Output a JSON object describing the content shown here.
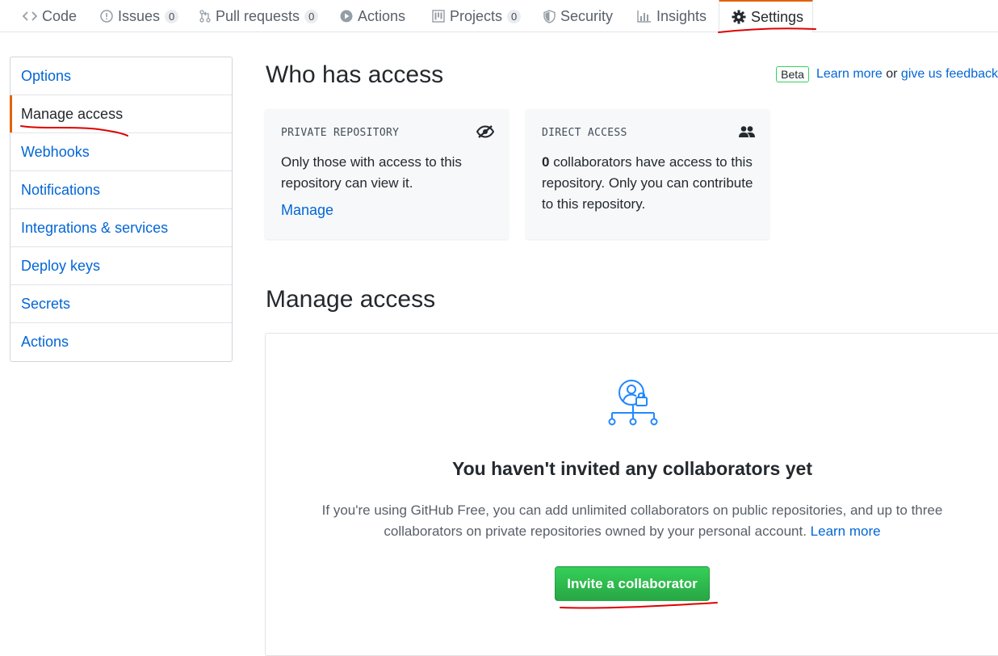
{
  "nav": {
    "tabs": [
      {
        "label": "Code",
        "icon": "code-icon"
      },
      {
        "label": "Issues",
        "icon": "issue-opened-icon",
        "count": "0"
      },
      {
        "label": "Pull requests",
        "icon": "git-pull-request-icon",
        "count": "0"
      },
      {
        "label": "Actions",
        "icon": "play-icon"
      },
      {
        "label": "Projects",
        "icon": "project-icon",
        "count": "0"
      },
      {
        "label": "Security",
        "icon": "shield-icon"
      },
      {
        "label": "Insights",
        "icon": "graph-icon"
      },
      {
        "label": "Settings",
        "icon": "gear-icon",
        "selected": true
      }
    ]
  },
  "sidebar": {
    "items": [
      {
        "label": "Options"
      },
      {
        "label": "Manage access",
        "selected": true
      },
      {
        "label": "Webhooks"
      },
      {
        "label": "Notifications"
      },
      {
        "label": "Integrations & services"
      },
      {
        "label": "Deploy keys"
      },
      {
        "label": "Secrets"
      },
      {
        "label": "Actions"
      }
    ]
  },
  "who": {
    "title": "Who has access",
    "beta_badge": "Beta",
    "learn_more": "Learn more",
    "or_text": " or ",
    "feedback": "give us feedback"
  },
  "private_box": {
    "title": "PRIVATE REPOSITORY",
    "icon": "eye-closed-icon",
    "text": "Only those with access to this repository can view it.",
    "link": "Manage"
  },
  "direct_box": {
    "title": "DIRECT ACCESS",
    "icon": "people-icon",
    "count": "0",
    "text": " collaborators have access to this repository. Only you can contribute to this repository."
  },
  "manage": {
    "title": "Manage access",
    "empty_icon": "person-lock-org-icon",
    "empty_title": "You haven't invited any collaborators yet",
    "empty_desc": "If you're using GitHub Free, you can add unlimited collaborators on public repositories, and up to three collaborators on private repositories owned by your personal account.",
    "learn_more": "Learn more",
    "invite_button": "Invite a collaborator"
  },
  "colors": {
    "link": "#0366d6",
    "accent": "#e36209",
    "button_green": "#28a745",
    "annotation_red": "#e00000"
  }
}
